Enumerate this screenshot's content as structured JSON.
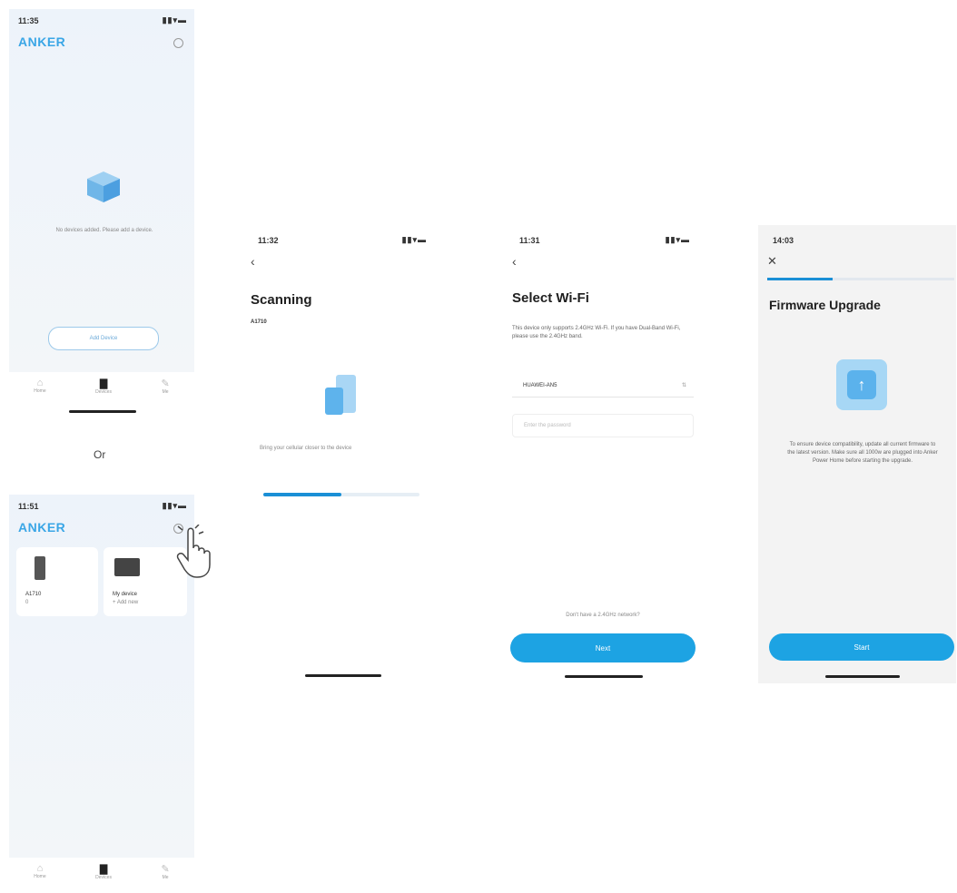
{
  "screen1": {
    "time": "11:35",
    "logo": "ANKER",
    "empty_text": "No devices added. Please add a device.",
    "add_button": "Add Device",
    "nav": [
      "Home",
      "Devices",
      "Me"
    ]
  },
  "or_text": "Or",
  "screen1b": {
    "time": "11:51",
    "logo": "ANKER",
    "device1": {
      "name": "A1710",
      "status": "0"
    },
    "device2": {
      "name": "My device",
      "status": "+ Add new"
    },
    "nav": [
      "Home",
      "Devices",
      "Me"
    ]
  },
  "screen2": {
    "time": "11:32",
    "title": "Scanning",
    "subtitle": "A1710",
    "hint": "Bring your cellular closer to the device",
    "progress": 0.5
  },
  "screen3": {
    "time": "11:31",
    "title": "Select Wi-Fi",
    "desc": "This device only supports 2.4GHz Wi-Fi. If you have Dual-Band Wi-Fi, please use the 2.4GHz band.",
    "wifi_value": "HUAWEI-AN5",
    "password_placeholder": "Enter the password",
    "link": "Don't have a 2.4GHz network?",
    "button": "Next"
  },
  "screen4": {
    "time": "14:03",
    "title": "Firmware Upgrade",
    "desc": "To ensure device compatibility, update all current firmware to the latest version. Make sure all 1000w are plugged into Anker Power Home before starting the upgrade.",
    "button": "Start",
    "progress": 0.35
  },
  "colors": {
    "accent": "#1da3e3",
    "logo": "#3aa6e6"
  },
  "icons": [
    "signal-icon",
    "wifi-icon",
    "battery-icon",
    "gear-icon",
    "box-icon",
    "back-icon",
    "close-icon",
    "upload-icon",
    "hand-pointer-icon"
  ]
}
